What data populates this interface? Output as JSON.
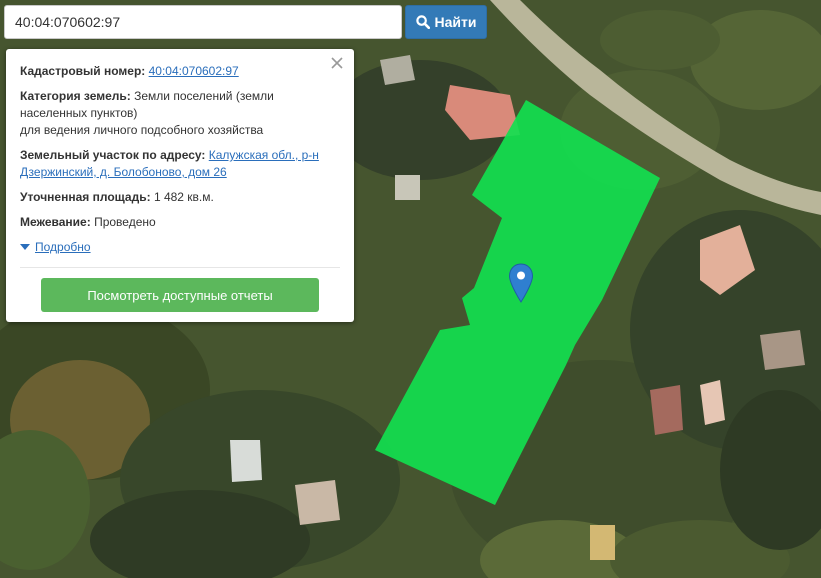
{
  "search": {
    "value": "40:04:070602:97",
    "button_label": "Найти",
    "button_icon": "search-icon"
  },
  "info": {
    "cadastral_label": "Кадастровый номер:",
    "cadastral_value": "40:04:070602:97",
    "category_label": "Категория земель:",
    "category_value": "Земли поселений (земли населенных пунктов)",
    "usage": "для ведения личного подсобного хозяйства",
    "address_label": "Земельный участок по адресу:",
    "address_value": "Калужская обл., р-н Дзержинский, д. Болобоново, дом 26",
    "area_label": "Уточненная площадь:",
    "area_value": "1 482 кв.м.",
    "survey_label": "Межевание:",
    "survey_value": "Проведено",
    "details_label": "Подробно",
    "report_button": "Посмотреть доступные отчеты"
  },
  "colors": {
    "parcel": "#12e04f",
    "pin": "#2f7fd0",
    "search_button": "#337ab7",
    "report_button": "#5cb85c"
  }
}
